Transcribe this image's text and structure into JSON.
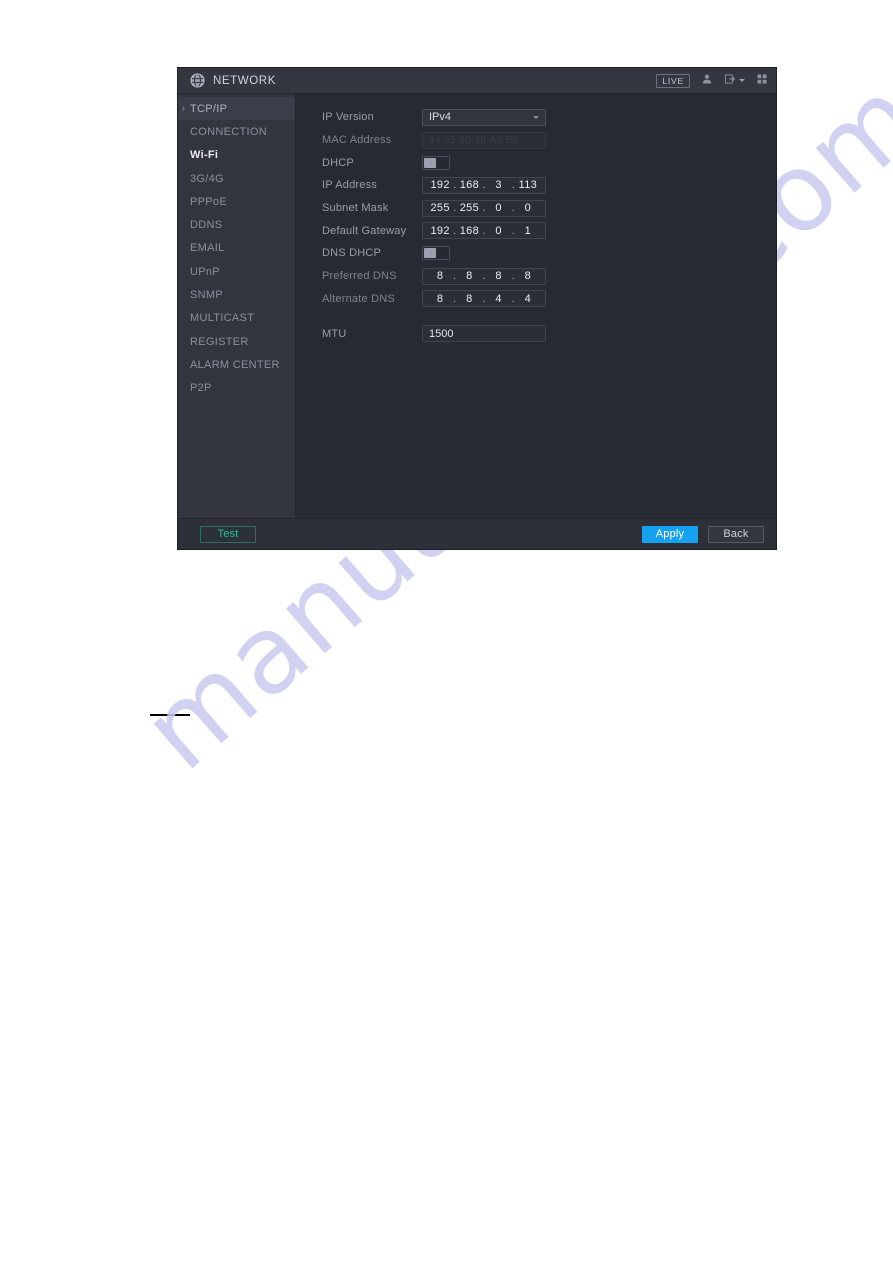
{
  "page": {
    "background_color": "#ffffff",
    "watermark_text": "manualshive.com",
    "watermark_color": "#c9c9ef"
  },
  "dialog": {
    "titlebar": {
      "icon": "globe-network-icon",
      "title": "NETWORK",
      "live_label": "LIVE",
      "icons": [
        "user-icon",
        "logout-icon",
        "chevron-down-icon",
        "grid-apps-icon"
      ]
    },
    "sidebar": {
      "items": [
        {
          "label": "TCP/IP",
          "selected": true,
          "bold": false
        },
        {
          "label": "CONNECTION",
          "selected": false,
          "bold": false
        },
        {
          "label": "Wi-Fi",
          "selected": false,
          "bold": true
        },
        {
          "label": "3G/4G",
          "selected": false,
          "bold": false
        },
        {
          "label": "PPPoE",
          "selected": false,
          "bold": false
        },
        {
          "label": "DDNS",
          "selected": false,
          "bold": false
        },
        {
          "label": "EMAIL",
          "selected": false,
          "bold": false
        },
        {
          "label": "UPnP",
          "selected": false,
          "bold": false
        },
        {
          "label": "SNMP",
          "selected": false,
          "bold": false
        },
        {
          "label": "MULTICAST",
          "selected": false,
          "bold": false
        },
        {
          "label": "REGISTER",
          "selected": false,
          "bold": false
        },
        {
          "label": "ALARM CENTER",
          "selected": false,
          "bold": false
        },
        {
          "label": "P2P",
          "selected": false,
          "bold": false
        }
      ]
    },
    "form": {
      "ip_version": {
        "label": "IP Version",
        "value": "IPv4"
      },
      "mac_address": {
        "label": "MAC Address",
        "value": "34:65:80:38:A3:B0"
      },
      "dhcp": {
        "label": "DHCP",
        "state": "off"
      },
      "ip_address": {
        "label": "IP Address",
        "octets": [
          "192",
          "168",
          "3",
          "113"
        ]
      },
      "subnet_mask": {
        "label": "Subnet Mask",
        "octets": [
          "255",
          "255",
          "0",
          "0"
        ]
      },
      "default_gateway": {
        "label": "Default Gateway",
        "octets": [
          "192",
          "168",
          "0",
          "1"
        ]
      },
      "dns_dhcp": {
        "label": "DNS DHCP",
        "state": "off"
      },
      "preferred_dns": {
        "label": "Preferred DNS",
        "octets": [
          "8",
          "8",
          "8",
          "8"
        ]
      },
      "alternate_dns": {
        "label": "Alternate DNS",
        "octets": [
          "8",
          "8",
          "4",
          "4"
        ]
      },
      "mtu": {
        "label": "MTU",
        "value": "1500"
      }
    },
    "footer": {
      "test_label": "Test",
      "apply_label": "Apply",
      "back_label": "Back",
      "test_color": "#2fbb93",
      "apply_color": "#15a2f0"
    }
  }
}
